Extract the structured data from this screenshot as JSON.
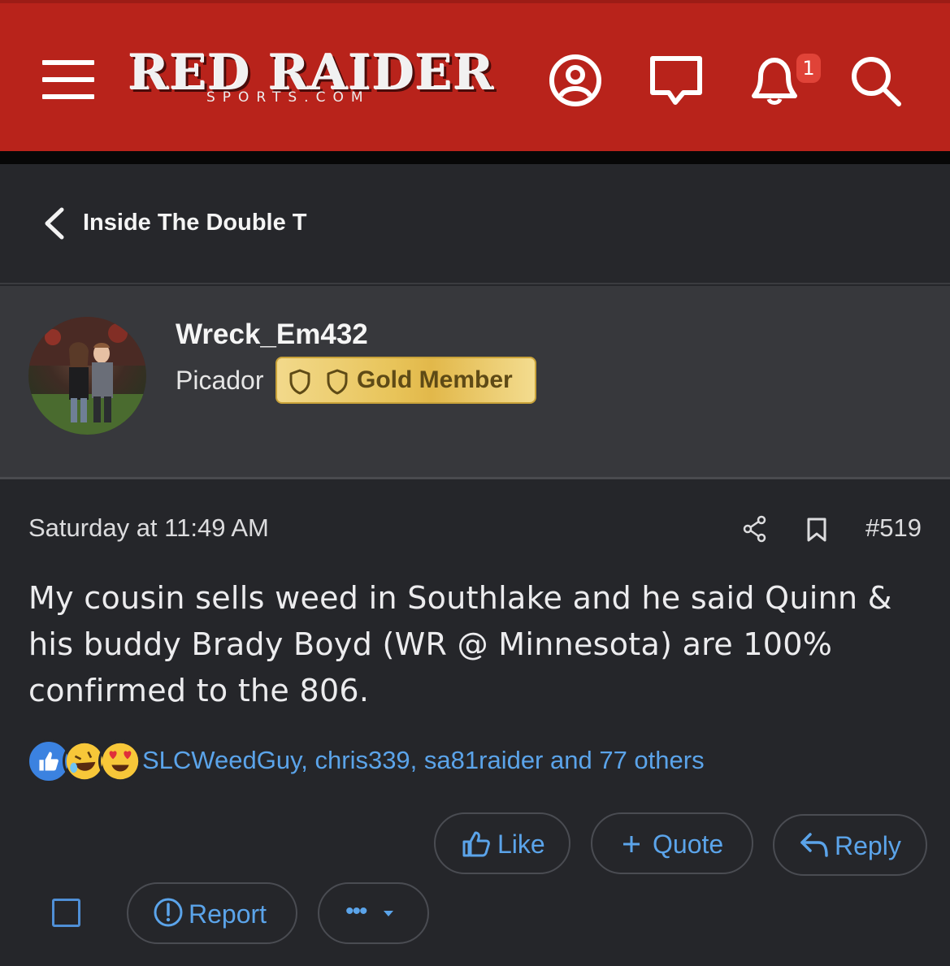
{
  "header": {
    "logo_main": "RED RAIDER",
    "logo_sub": "SPORTS.COM",
    "notification_count": "1",
    "colors": {
      "bar": "#b8231b",
      "badge": "#e04338"
    }
  },
  "breadcrumb": {
    "label": "Inside The Double T"
  },
  "user": {
    "name": "Wreck_Em432",
    "title": "Picador",
    "badge_label": "Gold Member"
  },
  "post": {
    "timestamp": "Saturday at 11:49 AM",
    "number": "#519",
    "body": "My cousin sells weed in Southlake and he said Quinn & his buddy Brady Boyd (WR @ Minnesota) are 100% confirmed to the 806."
  },
  "reactions": {
    "icons": [
      "like-reaction-icon",
      "laugh-reaction-icon",
      "love-reaction-icon"
    ],
    "names": "SLCWeedGuy, chris339, sa81raider and 77 others"
  },
  "actions": {
    "like": "Like",
    "quote": "Quote",
    "reply": "Reply",
    "report": "Report",
    "more": "•••"
  },
  "colors": {
    "link_blue": "#5ba4ea",
    "page_bg": "#25262a",
    "user_block_bg": "#37383c",
    "gold": "#e8c45a"
  }
}
